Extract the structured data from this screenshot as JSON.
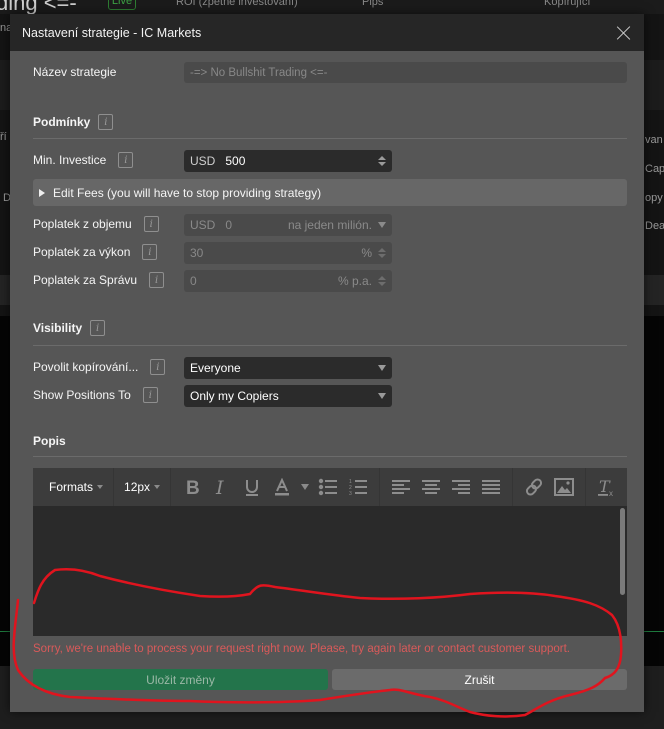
{
  "background": {
    "title_fragment": "ding <=-",
    "live_badge": "Live",
    "col1": "ROI (zpětné investování)",
    "col2": "Pips",
    "col3": "Kopírující",
    "left_frag1": "na",
    "left_frag2": "ří",
    "left_frag3": "D",
    "right_frag1": "van",
    "right_frag2": "Cap",
    "right_frag3": "opy",
    "right_frag4": "Dea"
  },
  "dialog": {
    "title": "Nastavení strategie - IC Markets",
    "name_label": "Název strategie",
    "name_value": "-=> No Bullshit Trading <=-",
    "conditions_heading": "Podmínky",
    "min_invest_label": "Min. Investice",
    "min_invest_currency": "USD",
    "min_invest_value": "500",
    "edit_fees_label": "Edit Fees (you will have to stop providing strategy)",
    "volume_fee_label": "Poplatek z objemu",
    "volume_fee_currency": "USD",
    "volume_fee_value": "0",
    "volume_fee_unit": "na jeden milión.",
    "performance_fee_label": "Poplatek za výkon",
    "performance_fee_value": "30",
    "performance_fee_unit": "%",
    "management_fee_label": "Poplatek za Správu",
    "management_fee_value": "0",
    "management_fee_unit": "% p.a.",
    "visibility_heading": "Visibility",
    "allow_copy_label": "Povolit kopírování...",
    "allow_copy_value": "Everyone",
    "show_positions_label": "Show Positions To",
    "show_positions_value": "Only my Copiers",
    "description_heading": "Popis",
    "editor": {
      "formats_label": "Formats",
      "font_size_label": "12px",
      "buttons": [
        "bold",
        "italic",
        "underline",
        "text-color",
        "bullet-list",
        "numbered-list",
        "align-left",
        "align-center",
        "align-right",
        "justify",
        "link",
        "image",
        "clear-formatting"
      ]
    },
    "error_message": "Sorry, we're unable to process your request right now. Please, try again later or contact customer support.",
    "save_label": "Uložit změny",
    "cancel_label": "Zrušit",
    "info_glyph": "i"
  },
  "annotation": {
    "color": "#e0141e",
    "description": "red freehand circle around error message and buttons"
  }
}
